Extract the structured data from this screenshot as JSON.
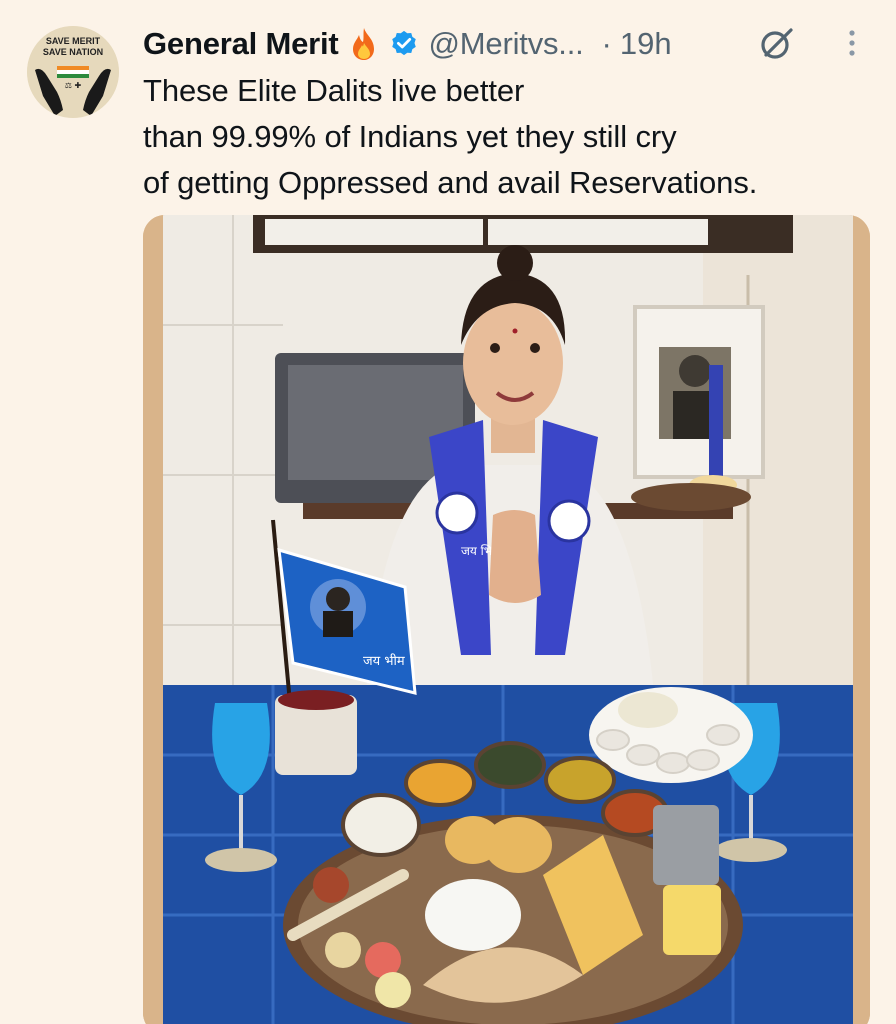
{
  "account": {
    "avatar_icon": "save-merit-hands-logo-icon",
    "avatar_text_line1": "SAVE MERIT",
    "avatar_text_line2": "SAVE NATION",
    "name": "General Merit",
    "name_emoji_icon": "fire-icon",
    "verified_icon": "verified-badge-icon",
    "handle": "@Meritvs...",
    "separator": "·",
    "time": "19h"
  },
  "actions": {
    "grok_icon": "grok-icon",
    "more_icon": "more-vertical-icon"
  },
  "tweet": {
    "lines": [
      "These Elite Dalits live better",
      "than 99.99% of Indians yet they still cry",
      "of getting Oppressed and avail Reservations."
    ]
  },
  "media": {
    "type": "photo",
    "flag_text": "जय भीम",
    "scarf_text": "जय भिम"
  },
  "colors": {
    "background": "#fcf3e8",
    "verified": "#1d9bf0",
    "secondary_text": "#536471",
    "scarf_blue": "#3b46c8",
    "tablecloth_blue": "#1f4fa3"
  }
}
